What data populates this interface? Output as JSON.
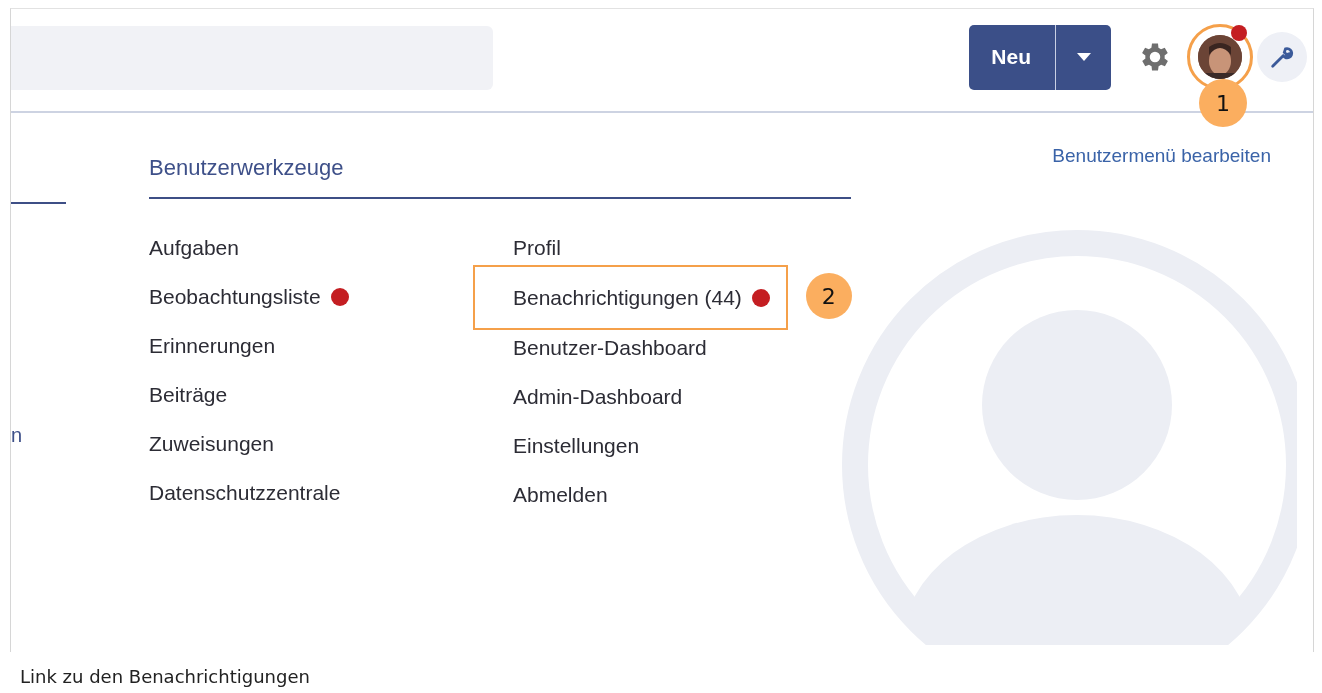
{
  "header": {
    "new_button": "Neu",
    "avatar_notification": true,
    "avatar_annotation": "1"
  },
  "left_column": {
    "text": "n"
  },
  "section": {
    "title": "Benutzerwerkzeuge",
    "columns": [
      [
        {
          "label": "Aufgaben",
          "notification": false,
          "highlighted": false
        },
        {
          "label": "Beobachtungsliste",
          "notification": true,
          "highlighted": false
        },
        {
          "label": "Erinnerungen",
          "notification": false,
          "highlighted": false
        },
        {
          "label": "Beiträge",
          "notification": false,
          "highlighted": false
        },
        {
          "label": "Zuweisungen",
          "notification": false,
          "highlighted": false
        },
        {
          "label": "Datenschutzzentrale",
          "notification": false,
          "highlighted": false
        }
      ],
      [
        {
          "label": "Profil",
          "notification": false,
          "highlighted": false
        },
        {
          "label": "Benachrichtigungen (44)",
          "notification": true,
          "highlighted": true,
          "annotation": "2"
        },
        {
          "label": "Benutzer-Dashboard",
          "notification": false,
          "highlighted": false
        },
        {
          "label": "Admin-Dashboard",
          "notification": false,
          "highlighted": false
        },
        {
          "label": "Einstellungen",
          "notification": false,
          "highlighted": false
        },
        {
          "label": "Abmelden",
          "notification": false,
          "highlighted": false
        }
      ]
    ]
  },
  "edit_link": "Benutzermenü bearbeiten",
  "caption": "Link zu den Benachrichtigungen"
}
